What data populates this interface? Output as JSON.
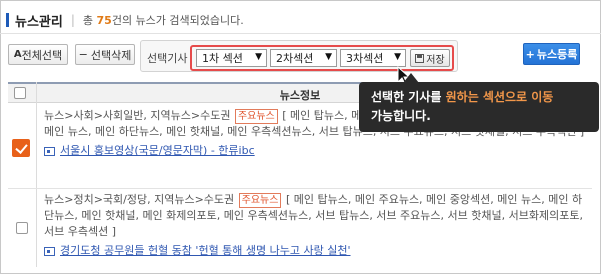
{
  "header": {
    "title": "뉴스관리",
    "count_prefix": "총",
    "count": "75",
    "count_suffix": "건의 뉴스가 검색되었습니다."
  },
  "toolbar": {
    "select_all": "전체선택",
    "delete_selected": "선택삭제",
    "move_label": "선택기사",
    "section1": "1차 섹션",
    "section2": "2차섹션",
    "section3": "3차섹션",
    "save": "저장",
    "register": "뉴스등록"
  },
  "table": {
    "header": "뉴스정보"
  },
  "rows": [
    {
      "checked": true,
      "path": "뉴스>사회>사회일반, 지역뉴스>수도권",
      "badge": "주요뉴스",
      "sections": "[ 메인 탑뉴스, 메인 주요뉴스, 메인 중앙섹션, 메인 화제의동영상, 메인 뉴스, 메인 하단뉴스, 메인 핫채널, 메인 우측섹션뉴스, 서브 탑뉴스, 서브 주요뉴스, 서브 핫채널, 서브 우측섹션 ]",
      "link": "서울시 홍보영상(국문/영문자막) - 한류ibc"
    },
    {
      "checked": false,
      "path": "뉴스>정치>국회/정당, 지역뉴스>수도권",
      "badge": "주요뉴스",
      "sections": "[ 메인 탑뉴스, 메인 주요뉴스, 메인 중앙섹션, 메인 뉴스, 메인 하단뉴스, 메인 핫채널, 메인 화제의포토, 메인 우측섹션뉴스, 서브 탑뉴스, 서브 주요뉴스, 서브 핫채널, 서브화제의포토, 서브 우측섹션 ]",
      "link": "경기도청 공무원들 헌혈 동참 '헌혈 통해 생명 나누고 사랑 실천'"
    }
  ],
  "tooltip": {
    "pre": "선택한 기사를 ",
    "highlight": "원하는 섹션으로 이동",
    "post": "가능합니다."
  },
  "colors": {
    "accent": "#e07b18",
    "highlight_box": "#e64b4b",
    "primary_button": "#2473d6",
    "link": "#2f57b1"
  }
}
